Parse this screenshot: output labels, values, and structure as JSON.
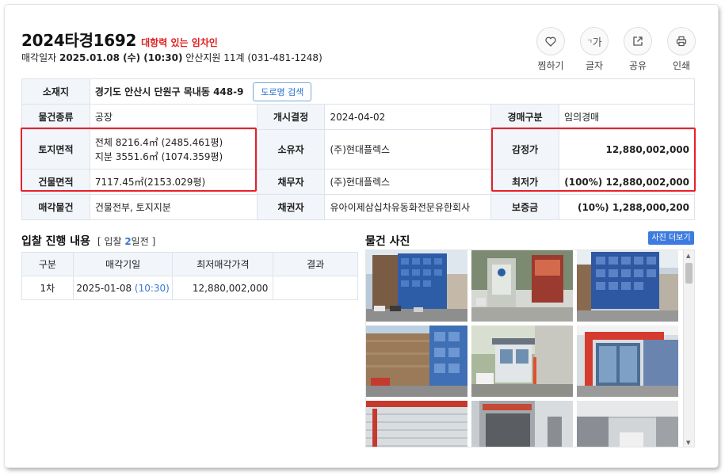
{
  "header": {
    "case_no": "2024타경1692",
    "case_tag": "대항력 있는 임차인",
    "sale_prefix": "매각일자",
    "sale_date": "2025.01.08 (수) (10:30)",
    "court": "안산지원 11계 (031-481-1248)"
  },
  "actions": [
    {
      "label": "찜하기",
      "icon": "heart-icon"
    },
    {
      "label": "글자",
      "icon": "font-size-icon"
    },
    {
      "label": "공유",
      "icon": "share-icon"
    },
    {
      "label": "인쇄",
      "icon": "print-icon"
    }
  ],
  "info": {
    "location_label": "소재지",
    "location_value": "경기도 안산시 단원구 목내동 448-9",
    "road_btn": "도로명 검색",
    "type_label": "물건종류",
    "type_value": "공장",
    "start_label": "개시결정",
    "start_value": "2024-04-02",
    "auction_kind_label": "경매구분",
    "auction_kind_value": "임의경매",
    "land_label": "토지면적",
    "land_total": "전체 8216.4㎡ (2485.461평)",
    "land_share": "지분 3551.6㎡ (1074.359평)",
    "owner_label": "소유자",
    "owner_value": "(주)현대플렉스",
    "appraisal_label": "감정가",
    "appraisal_value": "12,880,002,000",
    "building_label": "건물면적",
    "building_value": "7117.45㎡(2153.029평)",
    "debtor_label": "채무자",
    "debtor_value": "(주)현대플렉스",
    "min_price_label": "최저가",
    "min_price_value": "(100%) 12,880,002,000",
    "sale_item_label": "매각물건",
    "sale_item_value": "건물전부, 토지지분",
    "creditor_label": "채권자",
    "creditor_value": "유아이제삼십차유동화전문유한회사",
    "deposit_label": "보증금",
    "deposit_value": "(10%) 1,288,000,200"
  },
  "bid_section": {
    "title": "입찰 진행 내용",
    "sub_open": "[ 입찰",
    "sub_num": "2",
    "sub_close": "일전 ]",
    "headers": [
      "구분",
      "매각기일",
      "최저매각가격",
      "결과"
    ],
    "rows": [
      {
        "round": "1차",
        "date": "2025-01-08",
        "time": "(10:30)",
        "price": "12,880,002,000",
        "result": ""
      }
    ]
  },
  "photo_section": {
    "title": "물건 사진",
    "more_btn": "사진 더보기",
    "photos": [
      "building-blue-facade-photo",
      "gate-sign-photo",
      "building-blue-glass-photo",
      "building-side-wall-photo",
      "guard-booth-photo",
      "red-entrance-photo",
      "roller-door-photo",
      "loading-bay-photo",
      "warehouse-interior-photo"
    ]
  },
  "colors": {
    "accent_blue": "#3a78d4",
    "alert_red": "#e02020",
    "header_bg": "#f2f6fa",
    "border": "#dde3ea"
  }
}
